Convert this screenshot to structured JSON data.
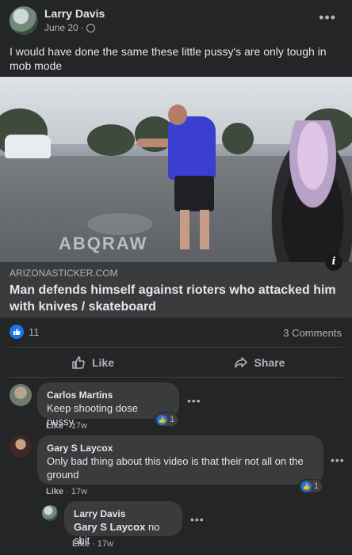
{
  "post": {
    "author": "Larry Davis",
    "date": "June 20",
    "separator": "·",
    "text": "I would have done the same these little pussy's are only tough in mob mode",
    "more_icon": "ellipsis-icon",
    "privacy_icon": "globe-icon"
  },
  "media": {
    "watermark": "ABQRAW",
    "info_label": "i"
  },
  "link": {
    "domain": "ARIZONASTICKER.COM",
    "title": "Man defends himself against rioters who attacked him with knives / skateboard"
  },
  "stats": {
    "likes": "11",
    "comments": "3 Comments"
  },
  "actions": {
    "like": "Like",
    "share": "Share"
  },
  "comments": [
    {
      "name": "Carlos Martins",
      "text": "Keep shooting dose pussy.",
      "like_label": "Like",
      "time": "17w",
      "reactions": "1"
    },
    {
      "name": "Gary S Laycox",
      "text": "Only bad thing about this video is that their not all on the ground",
      "like_label": "Like",
      "time": "17w",
      "reactions": "1"
    },
    {
      "name": "Larry Davis",
      "mention": "Gary S Laycox",
      "text": " no shit",
      "like_label": "Like",
      "time": "17w"
    }
  ],
  "colors": {
    "background": "#242526",
    "accent": "#1877f2",
    "bubble": "#3a3b3c"
  }
}
